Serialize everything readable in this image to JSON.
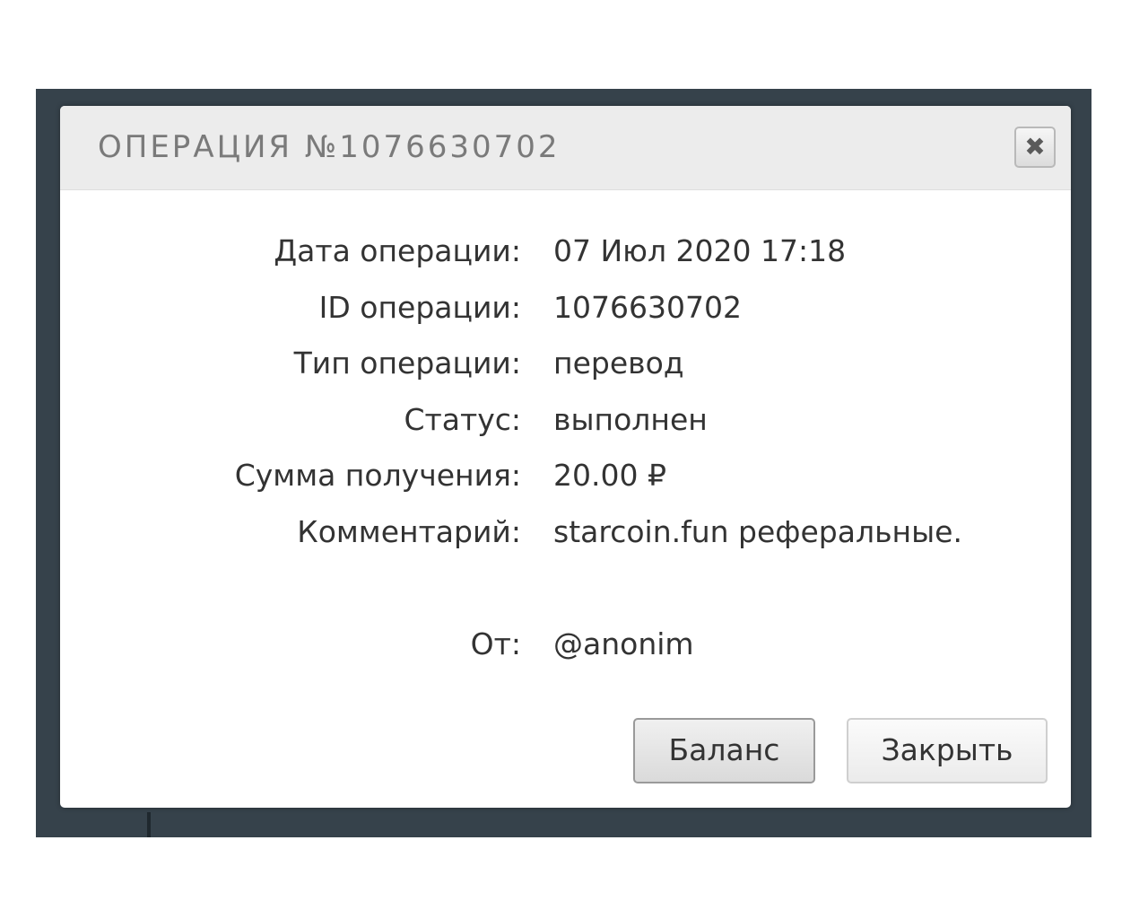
{
  "modal": {
    "title": "ОПЕРАЦИЯ №1076630702",
    "close_symbol": "✖",
    "close_icon": "close-icon"
  },
  "details": [
    {
      "label": "Дата операции:",
      "value": "07 Июл 2020 17:18"
    },
    {
      "label": "ID операции:",
      "value": "1076630702"
    },
    {
      "label": "Тип операции:",
      "value": "перевод"
    },
    {
      "label": "Статус:",
      "value": "выполнен"
    },
    {
      "label": "Сумма получения:",
      "value": "20.00 ₽"
    },
    {
      "label": "Комментарий:",
      "value": "starcoin.fun реферальные."
    }
  ],
  "sender": {
    "label": "От:",
    "value": "@anonim"
  },
  "buttons": {
    "balance_label": "Баланс",
    "close_label": "Закрыть"
  },
  "colors": {
    "backdrop": "#36424b",
    "header": "#ececec",
    "title_text": "#7a7a7a",
    "body_text": "#333333"
  }
}
